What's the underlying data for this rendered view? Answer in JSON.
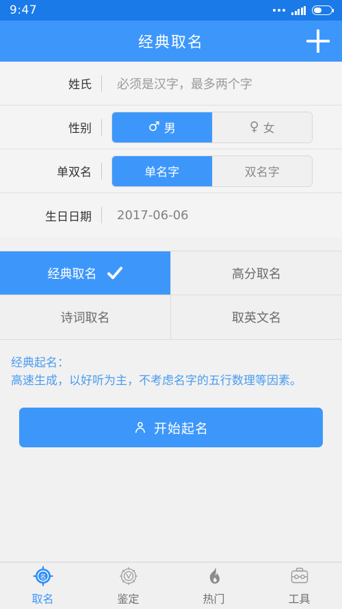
{
  "colors": {
    "accent": "#3d97fb",
    "status_bar": "#1a7ae8",
    "page_bg": "#f1f1f1",
    "panel_bg": "#f0f0f4",
    "desc_text": "#4a9cf0",
    "muted_text": "#8a8a8a"
  },
  "status_bar": {
    "time": "9:47",
    "icons": [
      "more-dots-icon",
      "signal-icon",
      "battery-icon"
    ]
  },
  "header": {
    "title": "经典取名",
    "add_icon": "plus-icon"
  },
  "form": {
    "rows": [
      {
        "label": "姓氏",
        "type": "input",
        "value": "",
        "placeholder": "必须是汉字，最多两个字"
      },
      {
        "label": "性别",
        "type": "segment",
        "options": [
          {
            "label": "男",
            "symbol": "♂",
            "icon": "male-icon",
            "selected": true
          },
          {
            "label": "女",
            "symbol": "♀",
            "icon": "female-icon",
            "selected": false
          }
        ]
      },
      {
        "label": "单双名",
        "type": "segment",
        "options": [
          {
            "label": "单名字",
            "symbol": "",
            "icon": "",
            "selected": true
          },
          {
            "label": "双名字",
            "symbol": "",
            "icon": "",
            "selected": false
          }
        ]
      },
      {
        "label": "生日日期",
        "type": "date",
        "value": "2017-06-06",
        "placeholder": ""
      }
    ]
  },
  "mode_grid": {
    "cells": [
      {
        "label": "经典取名",
        "selected": true,
        "icon": "check-icon"
      },
      {
        "label": "高分取名",
        "selected": false,
        "icon": ""
      },
      {
        "label": "诗词取名",
        "selected": false,
        "icon": ""
      },
      {
        "label": "取英文名",
        "selected": false,
        "icon": ""
      }
    ]
  },
  "description": {
    "title": "经典起名：",
    "body": "高速生成，以好听为主，不考虑名字的五行数理等因素。"
  },
  "cta": {
    "label": "开始起名",
    "icon": "person-icon"
  },
  "tabbar": {
    "items": [
      {
        "label": "取名",
        "icon": "naming-compass-icon",
        "active": true
      },
      {
        "label": "鉴定",
        "icon": "appraisal-compass-icon",
        "active": false
      },
      {
        "label": "热门",
        "icon": "flame-icon",
        "active": false
      },
      {
        "label": "工具",
        "icon": "toolbox-icon",
        "active": false
      }
    ]
  }
}
